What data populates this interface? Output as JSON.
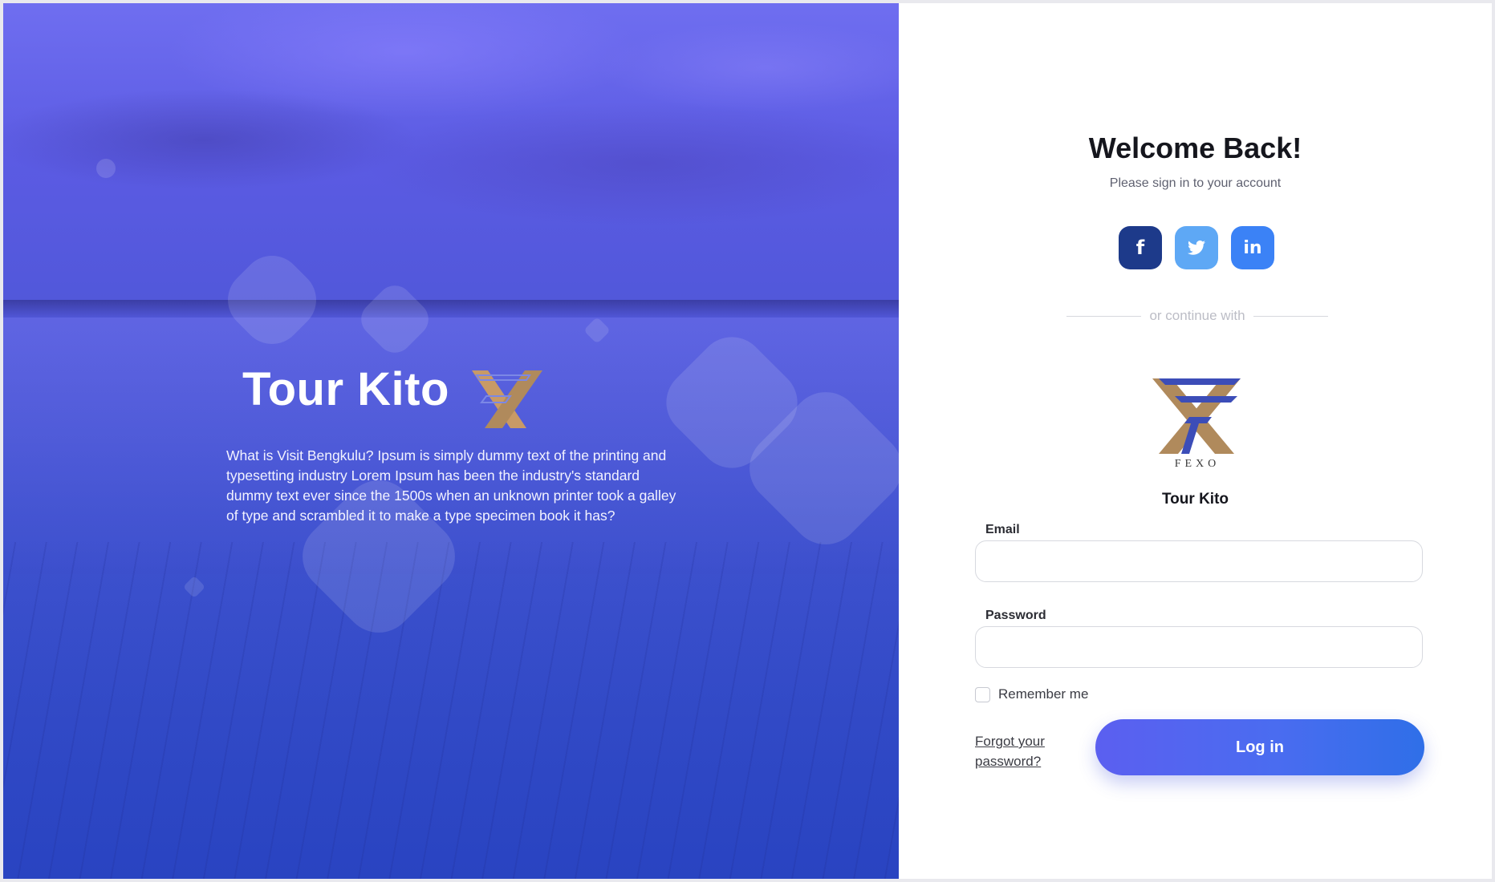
{
  "hero": {
    "title": "Tour Kito",
    "description": "What is Visit Bengkulu? Ipsum is simply dummy text of the printing and typesetting industry Lorem Ipsum has been the industry's standard dummy text ever since the 1500s when an unknown printer took a galley of type and scrambled it to make a type specimen book it has?"
  },
  "login": {
    "heading": "Welcome Back!",
    "subtitle": "Please sign in to your account",
    "socials": [
      {
        "name": "facebook",
        "glyph": "f",
        "color": "#1d3a8a"
      },
      {
        "name": "twitter",
        "glyph": "🐦",
        "color": "#5ea8f5"
      },
      {
        "name": "linkedin",
        "glyph": "in",
        "color": "#3b82f6"
      }
    ],
    "divider_text": "or continue with",
    "logo_wordmark": "FEXO",
    "brand_name": "Tour Kito",
    "email_label": "Email",
    "email_value": "",
    "password_label": "Password",
    "password_value": "",
    "remember_label": "Remember me",
    "remember_checked": false,
    "forgot_label": "Forgot your password?",
    "login_button": "Log in"
  },
  "colors": {
    "accent": "#4a6cf0",
    "hero_overlay": "#4f57d8",
    "logo_gold": "#b08a5c",
    "logo_blue": "#3c4db8"
  }
}
